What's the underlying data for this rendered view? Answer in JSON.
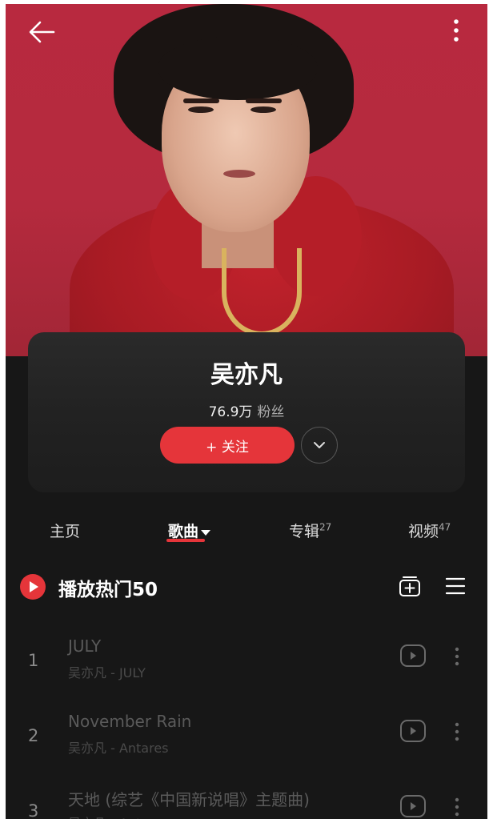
{
  "artist": {
    "name": "吴亦凡",
    "fans_count": "76.9万",
    "fans_label": "粉丝",
    "follow_label": "+ 关注"
  },
  "tabs": [
    {
      "label": "主页",
      "count": ""
    },
    {
      "label": "歌曲",
      "count": ""
    },
    {
      "label": "专辑",
      "count": "27"
    },
    {
      "label": "视频",
      "count": "47"
    }
  ],
  "active_tab": "歌曲",
  "section": {
    "title": "播放热门50"
  },
  "songs": [
    {
      "rank": "1",
      "title": "JULY",
      "subtitle": "吴亦凡 - JULY"
    },
    {
      "rank": "2",
      "title": "November Rain",
      "subtitle": "吴亦凡 - Antares"
    },
    {
      "rank": "3",
      "title": "天地 (综艺《中国新说唱》主题曲)",
      "subtitle": "吴亦凡 - Antares"
    }
  ],
  "icons": {
    "back": "back-arrow-icon",
    "more": "more-vertical-icon",
    "dropdown": "chevron-down-icon",
    "play_all": "play-icon",
    "add_to_playlist": "add-to-playlist-icon",
    "multi_select": "list-icon",
    "mv": "mv-play-icon"
  },
  "colors": {
    "accent": "#e5353a",
    "background": "#171717",
    "hero_background": "#b52a3e"
  }
}
